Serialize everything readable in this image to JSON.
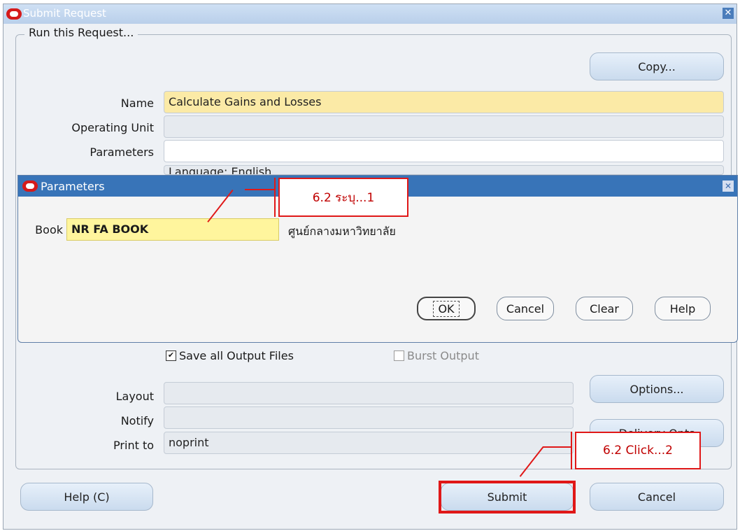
{
  "window": {
    "title": "Submit Request"
  },
  "group": {
    "title": "Run this Request..."
  },
  "buttons": {
    "copy": "Copy...",
    "options": "Options...",
    "delivery": "Delivery Opts",
    "help": "Help (C)",
    "submit": "Submit",
    "cancel": "Cancel"
  },
  "form": {
    "name_label": "Name",
    "name_value": "Calculate Gains and Losses",
    "ou_label": "Operating Unit",
    "ou_value": "",
    "params_label": "Parameters",
    "params_value": "",
    "lang_value": "Language: English",
    "layout_label": "Layout",
    "layout_value": "",
    "notify_label": "Notify",
    "notify_value": "",
    "printto_label": "Print to",
    "printto_value": "noprint"
  },
  "checkboxes": {
    "save_label": "Save all Output Files",
    "save_checked": "✔",
    "burst_label": "Burst Output"
  },
  "params_window": {
    "title": "Parameters",
    "book_label": "Book",
    "book_value": "NR FA BOOK",
    "book_desc": "ศูนย์กลางมหาวิทยาลัย",
    "ok": "OK",
    "cancel": "Cancel",
    "clear": "Clear",
    "help": "Help"
  },
  "annotations": {
    "step1": "6.2 ระบุ...1",
    "step2": "6.2 Click...2"
  }
}
